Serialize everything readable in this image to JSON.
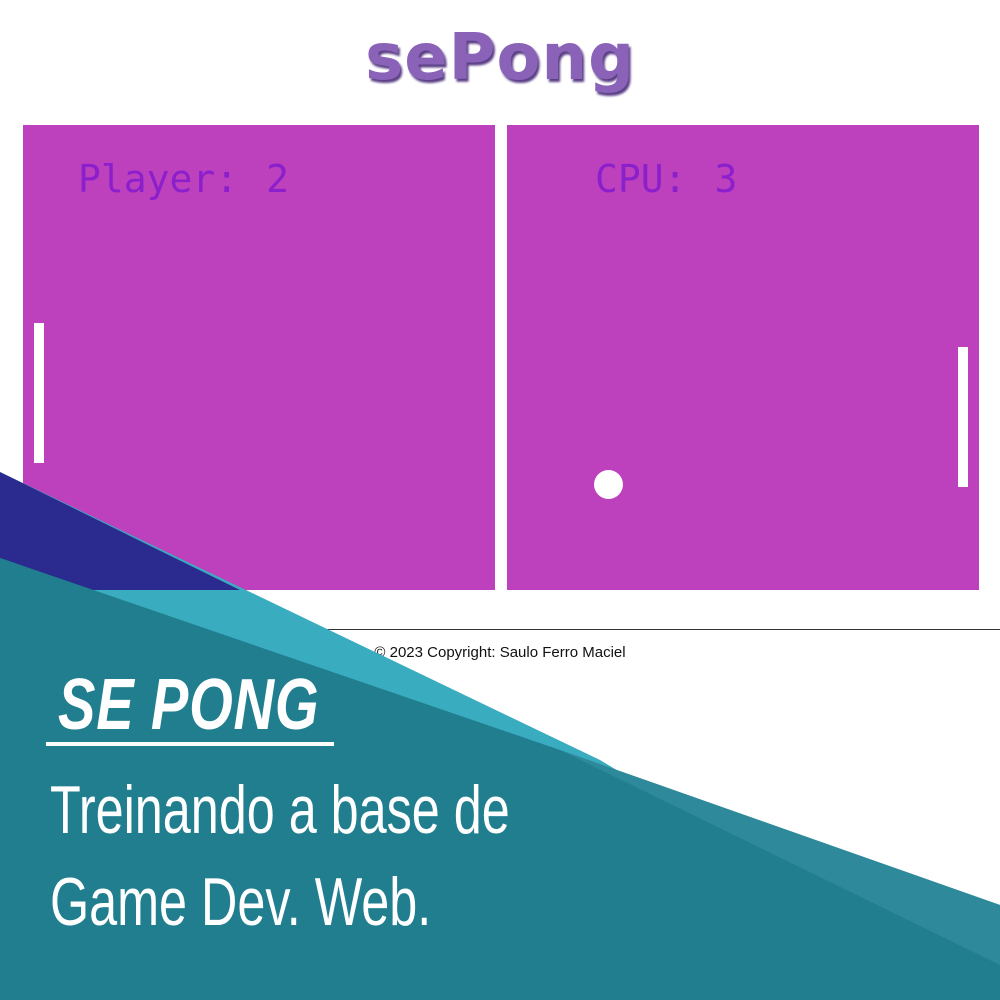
{
  "header": {
    "logo": "sePong"
  },
  "game": {
    "player_label": "Player:",
    "player_score": "2",
    "cpu_label": "CPU:",
    "cpu_score": "3"
  },
  "footer": {
    "copyright": "© 2023 Copyright: Saulo Ferro Maciel"
  },
  "banner": {
    "title": "SE PONG",
    "line1": "Treinando a base de",
    "line2": "Game Dev. Web."
  },
  "colors": {
    "field": "#bd40bd",
    "score_text": "#8c1fcc",
    "logo": "#8a63b8",
    "banner_teal": "#207e8f",
    "banner_cyan": "#3aacc0"
  }
}
